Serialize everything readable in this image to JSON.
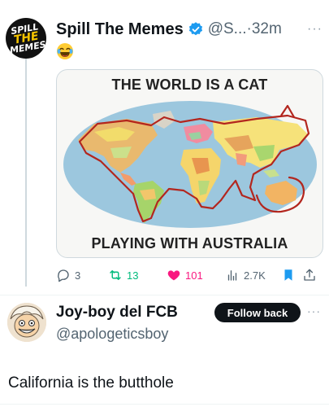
{
  "post": {
    "author_name": "Spill The Memes",
    "avatar_text": [
      "SPILL",
      "THE",
      "MEMES"
    ],
    "handle_time": "@S...·32m",
    "more": "···",
    "emoji": "laughing-with-tears",
    "media": {
      "top_caption": "THE WORLD IS A CAT",
      "bottom_caption": "PLAYING WITH AUSTRALIA",
      "outline_color": "#b3261e"
    },
    "actions": {
      "replies": "3",
      "reposts": "13",
      "likes": "101",
      "views": "2.7K"
    }
  },
  "reply": {
    "author_name": "Joy-boy del FCB",
    "handle": "@apologeticsboy",
    "follow_label": "Follow back",
    "more": "···",
    "text": "California is the butthole"
  },
  "colors": {
    "verified_blue": "#1d9bf0",
    "repost_green": "#00ba7c",
    "like_pink": "#f91880",
    "bookmark_blue": "#1d9bf0"
  }
}
